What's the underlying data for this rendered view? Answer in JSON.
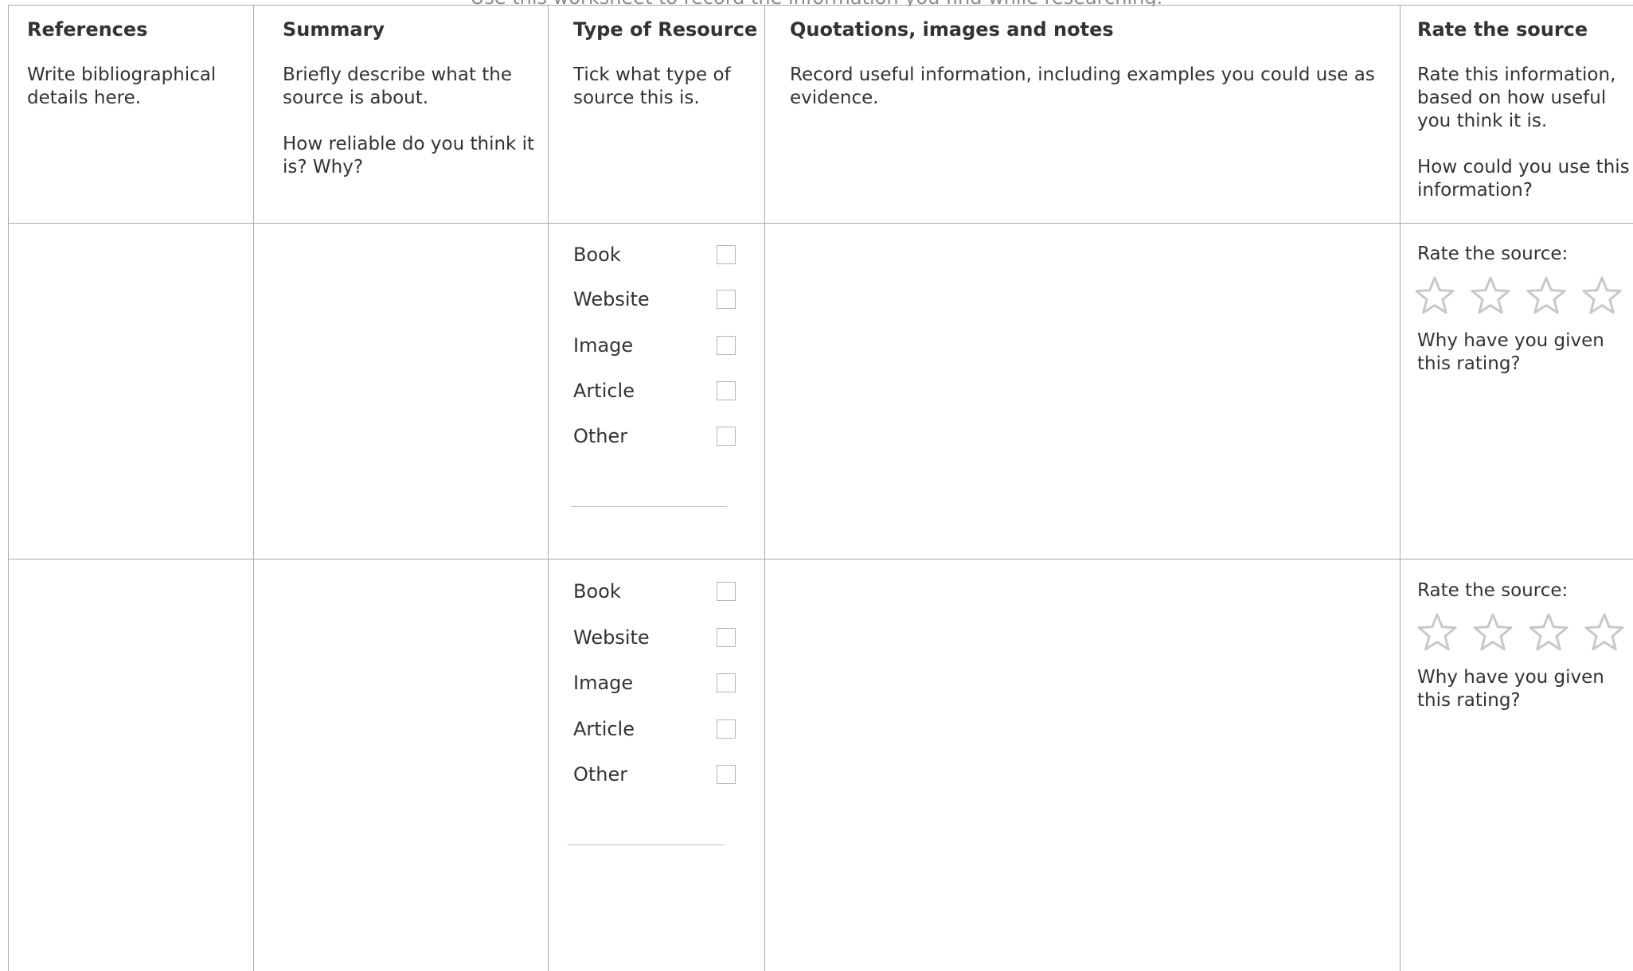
{
  "intro": "Use this worksheet to record the information you find while researching.",
  "columns": {
    "references": {
      "title": "References",
      "text": "Write bibliographical details here."
    },
    "summary": {
      "title": "Summary",
      "text1": "Briefly describe what the source is about.",
      "text2": "How reliable do you think it is? Why?"
    },
    "type": {
      "title": "Type of Resource",
      "text": "Tick what type of source this is."
    },
    "notes": {
      "title": "Quotations, images and notes",
      "text": "Record useful information, including examples you could use as evidence."
    },
    "rate": {
      "title": "Rate the source",
      "text1": "Rate this information, based on how useful you think it is.",
      "text2": "How could you use this information?"
    }
  },
  "resource_types": [
    "Book",
    "Website",
    "Image",
    "Article",
    "Other"
  ],
  "rows": [
    {
      "rate_label": "Rate the source:",
      "rating": 0,
      "why": "Why have you given this rating?",
      "other_value": ""
    },
    {
      "rate_label": "Rate the source:",
      "rating": 0,
      "why": "Why have you given this rating?",
      "other_value": ""
    }
  ],
  "colors": {
    "grid": "#aaaaaa",
    "text": "#333333",
    "star_outline": "#c8c8c8"
  }
}
